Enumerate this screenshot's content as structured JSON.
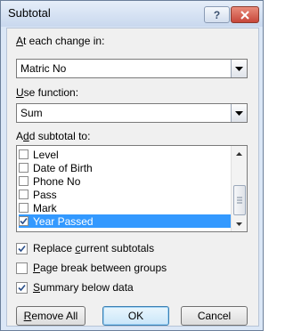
{
  "dialog": {
    "title": "Subtotal",
    "help_label": "?",
    "each_change": {
      "label_hotkey": "A",
      "label_rest": "t each change in:",
      "value": "Matric No"
    },
    "use_function": {
      "label_hotkey": "U",
      "label_rest": "se function:",
      "value": "Sum"
    },
    "add_subtotal": {
      "label_pre": "A",
      "label_hotkey": "d",
      "label_rest": "d subtotal to:",
      "items": [
        {
          "label": "Level",
          "checked": false
        },
        {
          "label": "Date of Birth",
          "checked": false
        },
        {
          "label": "Phone No",
          "checked": false
        },
        {
          "label": "Pass",
          "checked": false
        },
        {
          "label": "Mark",
          "checked": false
        },
        {
          "label": "Year Passed",
          "checked": true,
          "selected": true
        }
      ]
    },
    "options": [
      {
        "pre": "Replace ",
        "hotkey": "c",
        "rest": "urrent subtotals",
        "checked": true
      },
      {
        "pre": "",
        "hotkey": "P",
        "rest": "age break between groups",
        "checked": false
      },
      {
        "pre": "",
        "hotkey": "S",
        "rest": "ummary below data",
        "checked": true
      }
    ],
    "buttons": {
      "remove_all_hotkey": "R",
      "remove_all_rest": "emove All",
      "ok": "OK",
      "cancel": "Cancel"
    }
  },
  "colors": {
    "selection": "#3399ff",
    "close": "#c7473a",
    "frame": "#dbe7f6"
  },
  "icons": {
    "help": "help-icon",
    "close": "close-icon",
    "dropdown": "chevron-down-icon"
  }
}
